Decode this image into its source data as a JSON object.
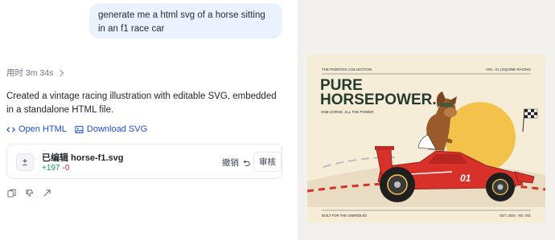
{
  "chat": {
    "user_message": "generate me a html svg of a horse sitting in an f1 race car",
    "elapsed": "用时 3m 34s",
    "reply": "Created a vintage racing illustration with editable SVG, embedded in a standalone HTML file.",
    "links": {
      "open_html": "Open HTML",
      "download_svg": "Download SVG"
    },
    "file_card": {
      "name": "已编辑 horse-f1.svg",
      "additions": "+197",
      "deletions": "-0",
      "undo_label": "撤销",
      "review_label": "审核"
    },
    "action_icons": [
      "copy-icon",
      "thumbs-down-icon",
      "share-icon"
    ]
  },
  "poster": {
    "collection": "THE PADDOCK COLLECTION",
    "volume": "VOL. 01 | EQUINE RACING",
    "title_line1": "PURE",
    "title_line2": "HORSEPOWER.",
    "subtitle": "ONE HORSE. ALL THE POWER.",
    "car_number": "01",
    "footer_left": "BUILT FOR THE UNBRIDLED",
    "footer_right": "EST. 2024 · NO. 001",
    "colors": {
      "background": "#f6edd9",
      "sun": "#f3c24b",
      "title": "#243b2e",
      "car_red": "#d8312a",
      "track_green": "#3d5a3c"
    }
  }
}
